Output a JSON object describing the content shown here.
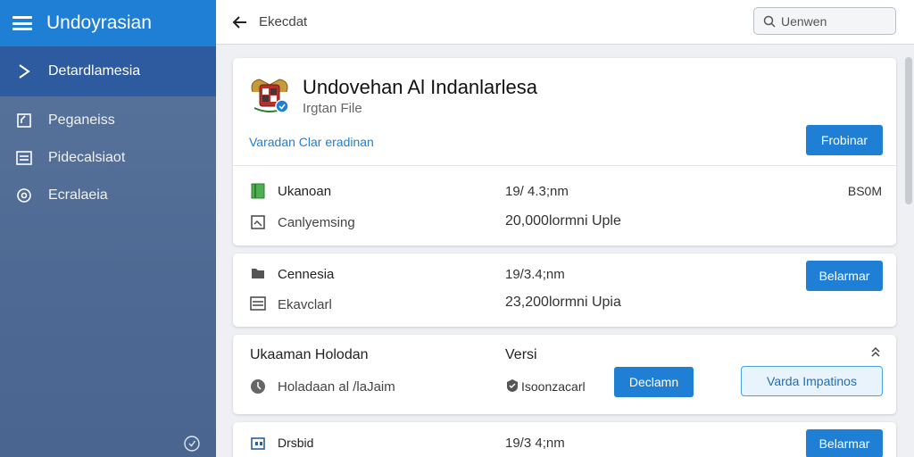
{
  "sidebar": {
    "title": "Undoyrasian",
    "active_item": "Detardlamesia",
    "items": [
      {
        "label": "Peganeiss",
        "icon": "document-edit-icon"
      },
      {
        "label": "Pidecalsiaot",
        "icon": "list-icon"
      },
      {
        "label": "Ecralaeia",
        "icon": "settings-icon"
      }
    ]
  },
  "topbar": {
    "title": "Ekecdat",
    "search_placeholder": "Uenwen"
  },
  "header_card": {
    "title": "Undovehan Al Indanlarlesa",
    "subtitle": "Irgtan File",
    "link": "Varadan Clar eradinan",
    "button": "Frobinar",
    "rows": [
      {
        "label": "Ukanoan",
        "value": "19/ 4.3;nm",
        "extra": "BS0M"
      },
      {
        "label": "Canlyemsing",
        "value": "20,000lormni Uple"
      }
    ]
  },
  "card2": {
    "button": "Belarmar",
    "rows": [
      {
        "label": "Cennesia",
        "value": "19/3.4;nm"
      },
      {
        "label": "Ekavclarl",
        "value": "23,200lormni Upia"
      }
    ]
  },
  "card3": {
    "title": "Ukaaman Holodan",
    "version_label": "Versi",
    "row_label": "Holadaan al /laJaim",
    "row_value": "Isoonzacarl",
    "button_primary": "Declamn",
    "button_outline": "Varda Impatinos"
  },
  "card4": {
    "label": "Drsbid",
    "value": "19/3 4;nm",
    "button": "Belarmar"
  },
  "colors": {
    "primary": "#1f7fd4",
    "sidebar": "#50709a",
    "sidebar_active": "#2e5aa0"
  }
}
